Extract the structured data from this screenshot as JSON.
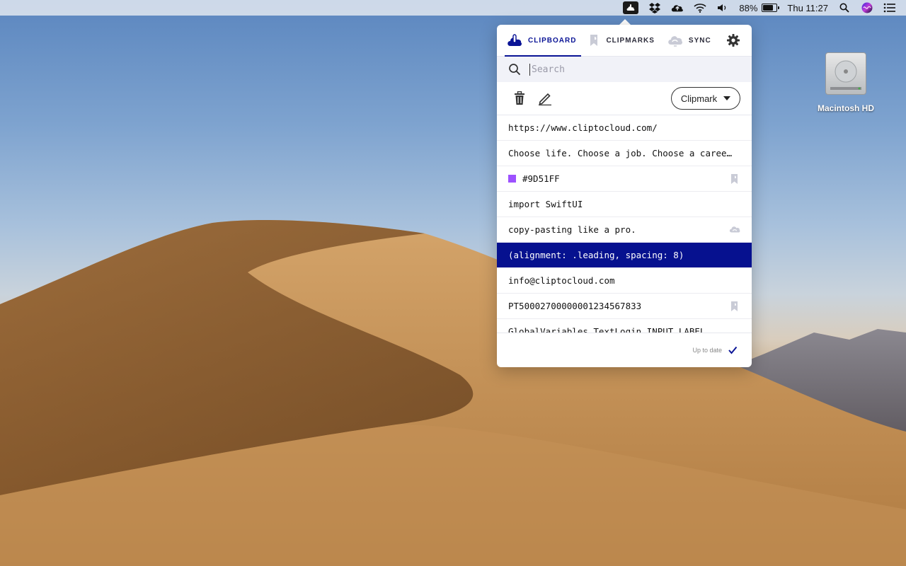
{
  "menubar": {
    "battery_percent": "88%",
    "battery_level": 0.88,
    "clock": "Thu 11:27",
    "icons": [
      "cliptocloud-icon",
      "dropbox-icon",
      "cloud-upload-icon",
      "wifi-icon",
      "volume-icon",
      "battery-icon",
      "spotlight-icon",
      "siri-icon",
      "notification-center-icon"
    ]
  },
  "desktop": {
    "disk_label": "Macintosh HD"
  },
  "popover": {
    "tabs": [
      {
        "label": "CLIPBOARD",
        "icon": "clipboard-cloud-icon",
        "active": true
      },
      {
        "label": "CLIPMARKS",
        "icon": "bookmark-icon",
        "active": false
      },
      {
        "label": "SYNC",
        "icon": "sync-cloud-icon",
        "active": false
      }
    ],
    "search": {
      "placeholder": "Search",
      "value": ""
    },
    "toolbar": {
      "clipmark_label": "Clipmark"
    },
    "items": [
      {
        "text": "https://www.cliptocloud.com/"
      },
      {
        "text": "Choose life. Choose a job. Choose a caree…"
      },
      {
        "text": "#9D51FF",
        "swatch": "#9D51FF",
        "icon": "bookmark-icon"
      },
      {
        "text": "import SwiftUI"
      },
      {
        "text": "copy-pasting like a pro.",
        "icon": "sync-cloud-icon"
      },
      {
        "text": "(alignment: .leading, spacing: 8)",
        "selected": true
      },
      {
        "text": "info@cliptocloud.com"
      },
      {
        "text": "PT50002700000001234567833",
        "icon": "bookmark-icon"
      },
      {
        "text": "GlobalVariables.TextLogin.INPUT_LABEL"
      }
    ],
    "footer": {
      "status": "Up to date"
    }
  },
  "colors": {
    "accent": "#0a1496",
    "selected_row": "#06118f",
    "swatch": "#9D51FF"
  }
}
